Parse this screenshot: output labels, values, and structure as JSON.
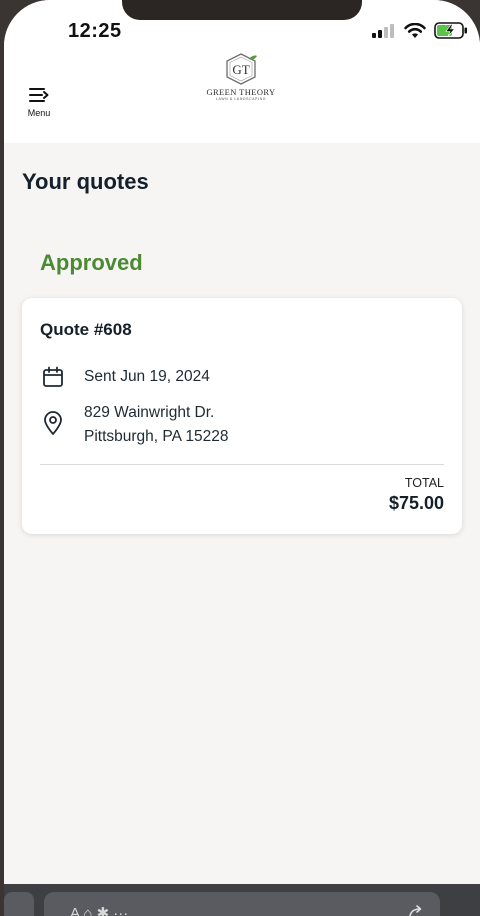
{
  "status_bar": {
    "time": "12:25",
    "icons": [
      "signal-icon",
      "wifi-icon",
      "battery-charging-icon"
    ]
  },
  "header": {
    "menu_label": "Menu",
    "logo_monogram": "GT",
    "logo_name": "GREEN THEORY",
    "logo_tagline": "LAWN & LANDSCAPING"
  },
  "page": {
    "title": "Your quotes"
  },
  "sections": [
    {
      "title": "Approved",
      "quotes": [
        {
          "title": "Quote #608",
          "sent": "Sent Jun 19, 2024",
          "address_line1": "829 Wainwright Dr.",
          "address_line2": "Pittsburgh, PA 15228",
          "total_label": "TOTAL",
          "total_value": "$75.00"
        }
      ]
    }
  ],
  "bottom_bar": {
    "field_text": "A  ⌂  ✱  ··· ",
    "icon": "share-icon"
  },
  "colors": {
    "accent_green": "#4b8a33",
    "text_dark": "#14202b",
    "background": "#f6f5f3",
    "card": "#ffffff"
  }
}
